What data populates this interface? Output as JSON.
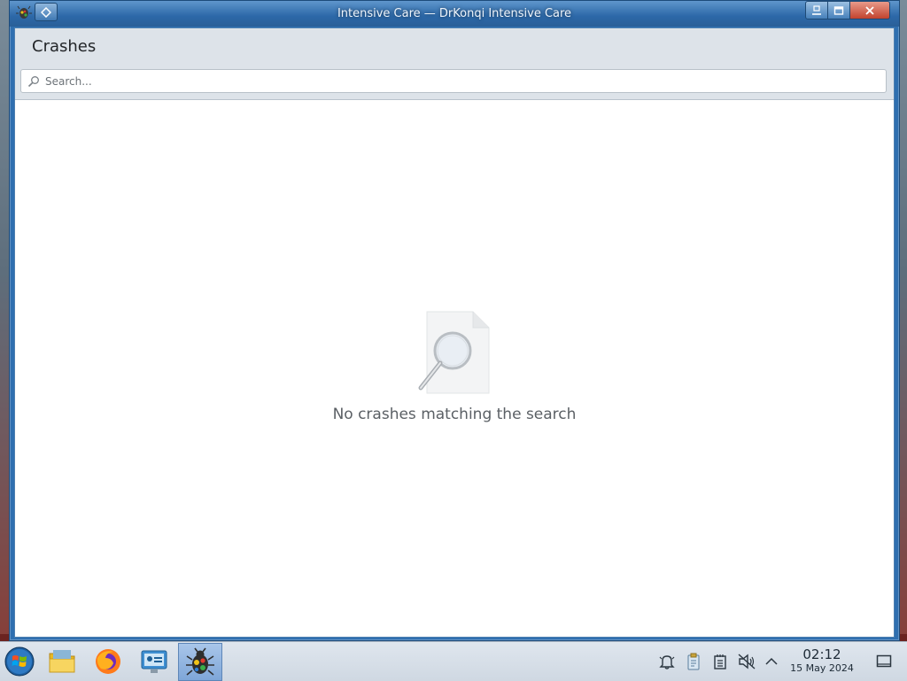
{
  "window": {
    "title": "Intensive Care — DrKonqi Intensive Care"
  },
  "header": {
    "page_title": "Crashes"
  },
  "search": {
    "placeholder": "Search...",
    "value": ""
  },
  "empty_state": {
    "message": "No crashes matching the search"
  },
  "taskbar": {
    "items": [
      {
        "icon": "start-orb-icon"
      },
      {
        "icon": "file-manager-icon"
      },
      {
        "icon": "firefox-icon"
      },
      {
        "icon": "system-settings-icon"
      },
      {
        "icon": "drkonqi-bug-icon",
        "active": true
      }
    ],
    "tray": [
      "notifications-bell-icon",
      "clipboard-icon",
      "device-icon",
      "volume-muted-icon",
      "expand-tray-icon"
    ],
    "clock": {
      "time": "02:12",
      "date": "15 May 2024"
    }
  },
  "colors": {
    "titlebar": "#2c68a8",
    "close_button": "#c2432e",
    "header_bg": "#dde3e9"
  }
}
